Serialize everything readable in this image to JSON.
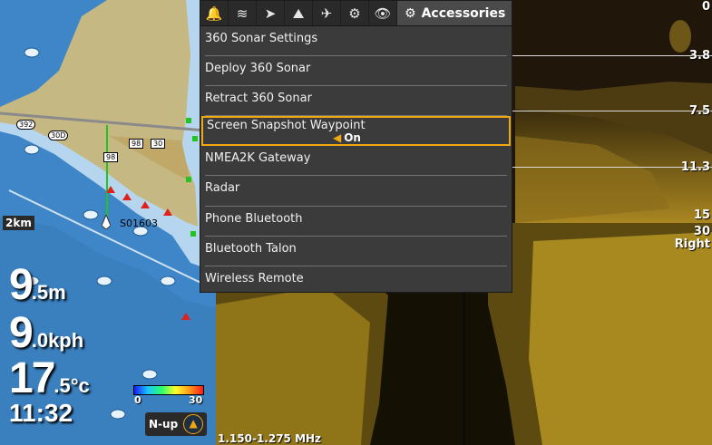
{
  "menu": {
    "tabs": [
      {
        "icon": "alarm-bell-icon"
      },
      {
        "icon": "sonar-icon"
      },
      {
        "icon": "navigation-icon"
      },
      {
        "icon": "chart-icon"
      },
      {
        "icon": "fishing-icon"
      },
      {
        "icon": "gear-icon"
      },
      {
        "icon": "eye-icon"
      }
    ],
    "active_tab": {
      "icon": "accessories-icon",
      "label": "Accessories"
    },
    "items": [
      {
        "label": "360 Sonar Settings"
      },
      {
        "label": "Deploy 360 Sonar"
      },
      {
        "label": "Retract 360 Sonar"
      },
      {
        "label": "Screen Snapshot Waypoint",
        "value": "On",
        "selected": true
      },
      {
        "label": "NMEA2K Gateway"
      },
      {
        "label": "Radar"
      },
      {
        "label": "Phone Bluetooth"
      },
      {
        "label": "Bluetooth Talon"
      },
      {
        "label": "Wireless Remote"
      }
    ]
  },
  "map": {
    "scale": "2km",
    "waypoint": "S01603",
    "roads": [
      "392",
      "30D",
      "98",
      "30",
      "98"
    ],
    "orientation": "N-up",
    "temp_legend": {
      "min": "0",
      "max": "30"
    }
  },
  "readouts": {
    "depth": {
      "value": "9",
      "decimal": ".5",
      "unit": "m"
    },
    "speed": {
      "value": "9",
      "decimal": ".0",
      "unit": "kph"
    },
    "temperature": {
      "value": "17",
      "decimal": ".5",
      "unit": "°c"
    },
    "time": "11:32"
  },
  "sonar": {
    "depth_scale": [
      "0",
      "3.8",
      "7.5",
      "11.3",
      "15"
    ],
    "side_range": "30",
    "side_label": "Right",
    "frequency": "1.150-1.275 MHz"
  },
  "colors": {
    "accent": "#f0a810",
    "waypoint_green": "#22c422",
    "water": "#3f86c8",
    "land": "#c6b882",
    "sonar": "#b89a2a"
  }
}
